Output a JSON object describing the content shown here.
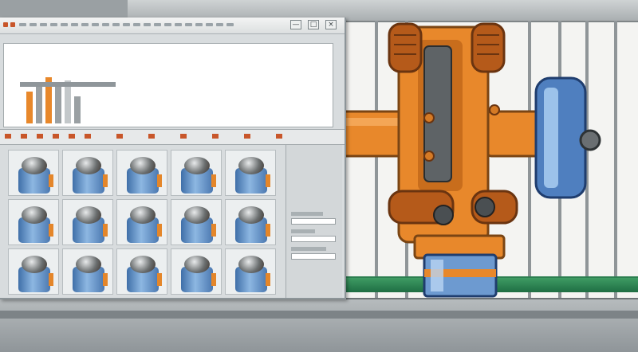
{
  "window": {
    "controls": {
      "minimize": "—",
      "maximize": "□",
      "close": "×"
    }
  },
  "thumbnails": {
    "rows": 3,
    "cols": 5
  },
  "colors": {
    "machine_orange": "#e8882b",
    "machine_blue": "#4f7fbf",
    "frame_green": "#2c8a55",
    "accent_orange": "#c8562a"
  },
  "icons": [
    "window-menu-icon",
    "minimize-icon",
    "maximize-icon",
    "close-icon"
  ]
}
